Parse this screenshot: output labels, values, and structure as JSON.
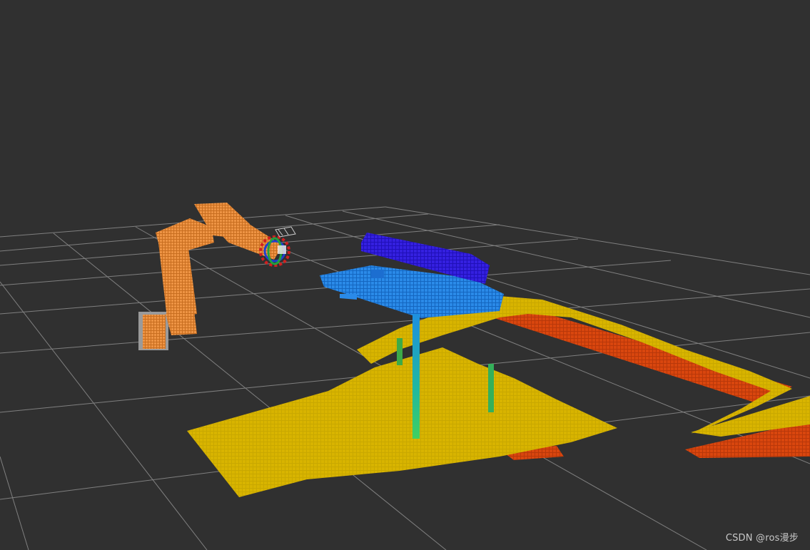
{
  "scene": {
    "background": "#303030",
    "grid_color": "#a0a0a0",
    "robot_color": "#e08a3a",
    "octomap_colors": {
      "low": "#d2ac00",
      "floor_red": "#d44a0e",
      "mid": "#2dae5e",
      "table": "#1f7fe0",
      "top": "#2a1ad8"
    },
    "interactive_marker": "end-effector-marker",
    "gripper_icon": "gripper-icon"
  },
  "watermark": {
    "text": "CSDN @ros漫步"
  }
}
